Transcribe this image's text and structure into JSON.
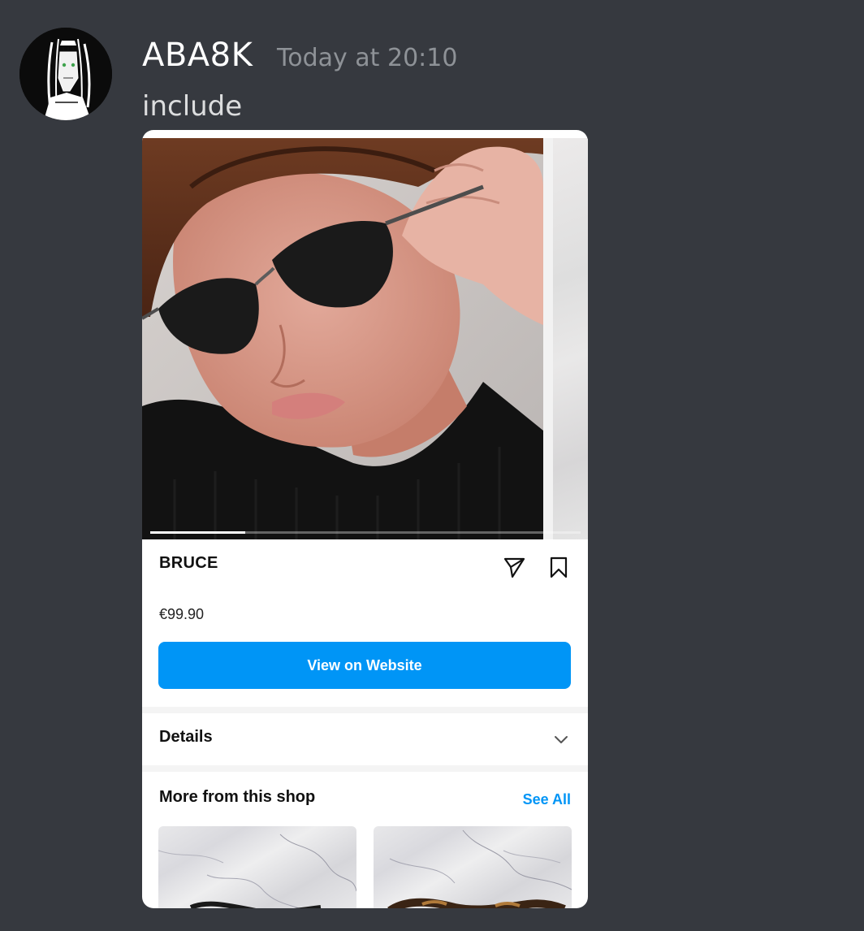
{
  "message": {
    "author": "ABA8K",
    "timestamp": "Today at 20:10",
    "text": "include"
  },
  "product_card": {
    "media": {
      "slide_index": 1,
      "slide_count": 4,
      "progress_fraction": 0.22
    },
    "title": "BRUCE",
    "price": "€99.90",
    "cta_label": "View on Website",
    "details_label": "Details",
    "more_title": "More from this shop",
    "see_all_label": "See All",
    "icons": {
      "share": "paper-plane-icon",
      "save": "bookmark-icon",
      "expand": "chevron-down-icon"
    },
    "colors": {
      "accent": "#0095f6",
      "background": "#36393f"
    }
  }
}
